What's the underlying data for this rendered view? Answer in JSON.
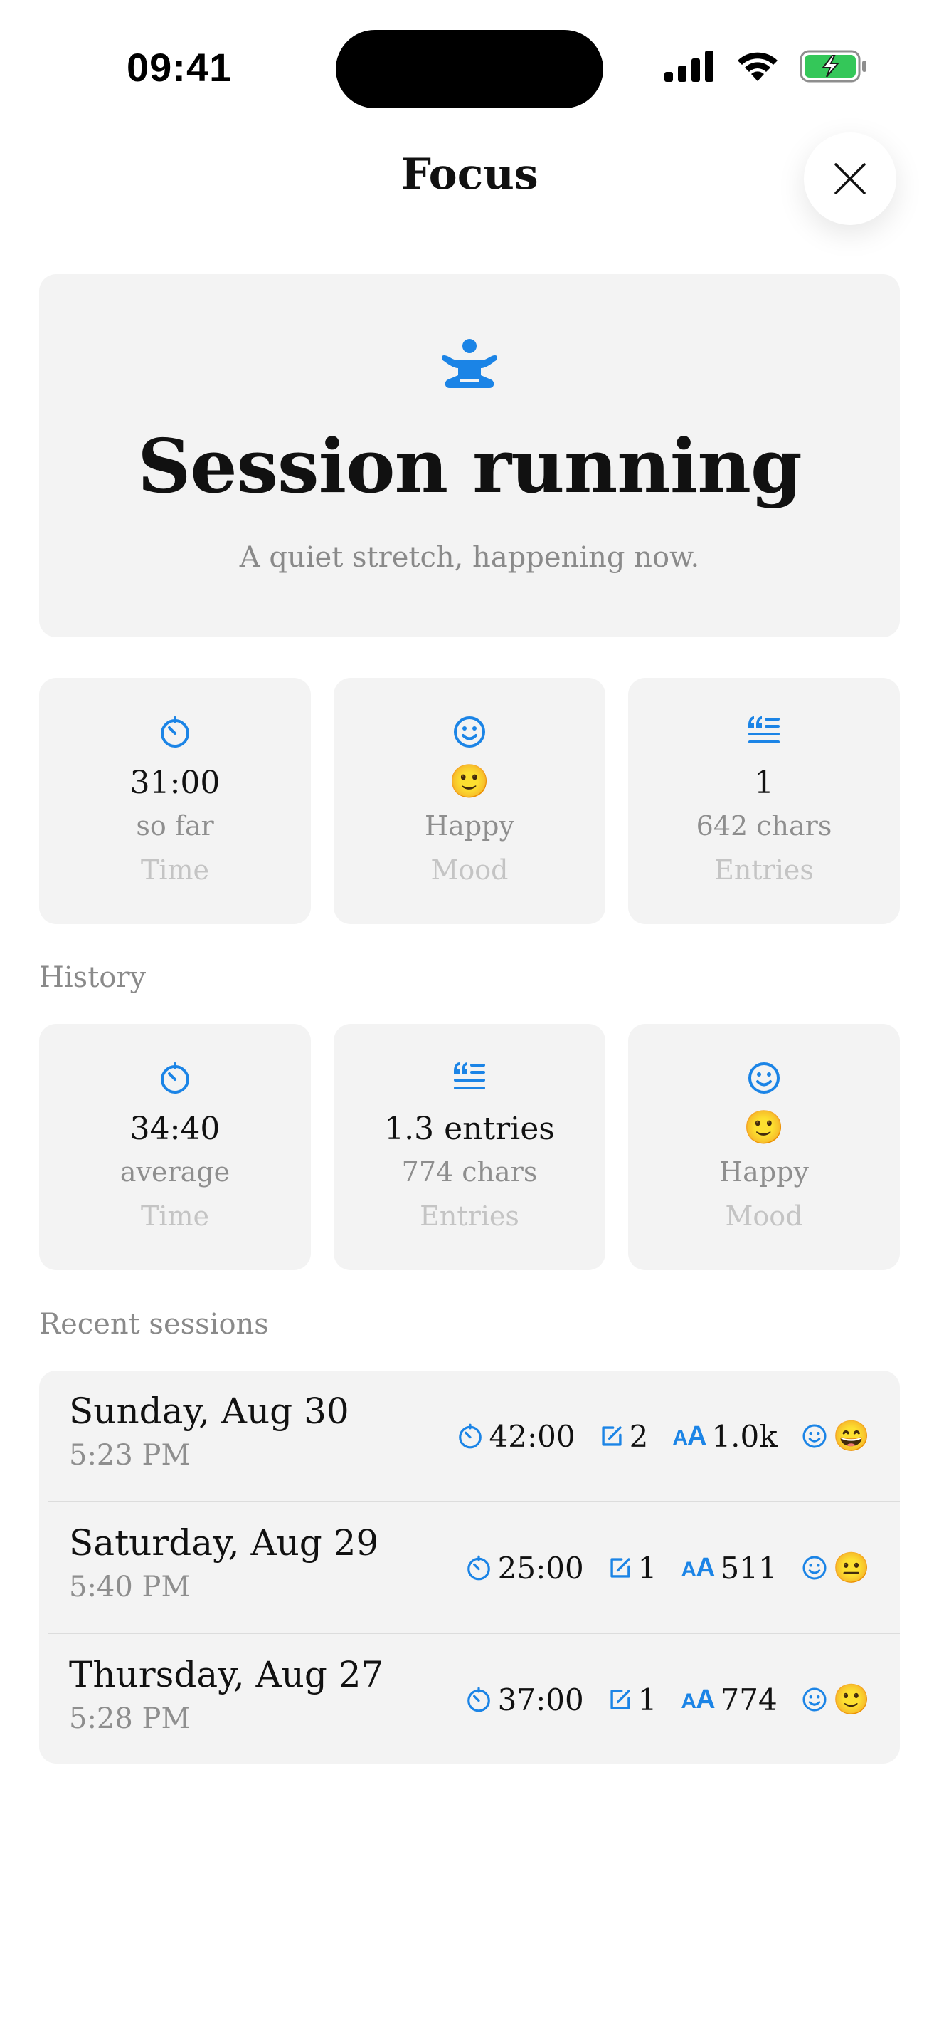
{
  "status_bar": {
    "time": "09:41"
  },
  "nav": {
    "title": "Focus"
  },
  "hero": {
    "title": "Session running",
    "subtitle": "A quiet stretch, happening now."
  },
  "current": [
    {
      "value": "31:00",
      "sub": "so far",
      "label": "Time",
      "icon": "timer-icon"
    },
    {
      "value": "🙂",
      "sub": "Happy",
      "label": "Mood",
      "icon": "smiley-icon"
    },
    {
      "value": "1",
      "sub": "642 chars",
      "label": "Entries",
      "icon": "quote-list-icon"
    }
  ],
  "history": {
    "heading": "History",
    "cards": [
      {
        "value": "34:40",
        "sub": "average",
        "label": "Time",
        "icon": "timer-icon"
      },
      {
        "value": "1.3 entries",
        "sub": "774 chars",
        "label": "Entries",
        "icon": "quote-list-icon"
      },
      {
        "value": "🙂",
        "sub": "Happy",
        "label": "Mood",
        "icon": "smiley-icon"
      }
    ]
  },
  "recent": {
    "heading": "Recent sessions",
    "sessions": [
      {
        "date": "Sunday, Aug 30",
        "time": "5:23 PM",
        "duration": "42:00",
        "entries": "2",
        "chars": "1.0k",
        "mood": "😄"
      },
      {
        "date": "Saturday, Aug 29",
        "time": "5:40 PM",
        "duration": "25:00",
        "entries": "1",
        "chars": "511",
        "mood": "😐"
      },
      {
        "date": "Thursday, Aug 27",
        "time": "5:28 PM",
        "duration": "37:00",
        "entries": "1",
        "chars": "774",
        "mood": "🙂"
      }
    ]
  },
  "colors": {
    "accent": "#1b84e6",
    "card": "#f3f3f3",
    "battery": "#34c759"
  }
}
